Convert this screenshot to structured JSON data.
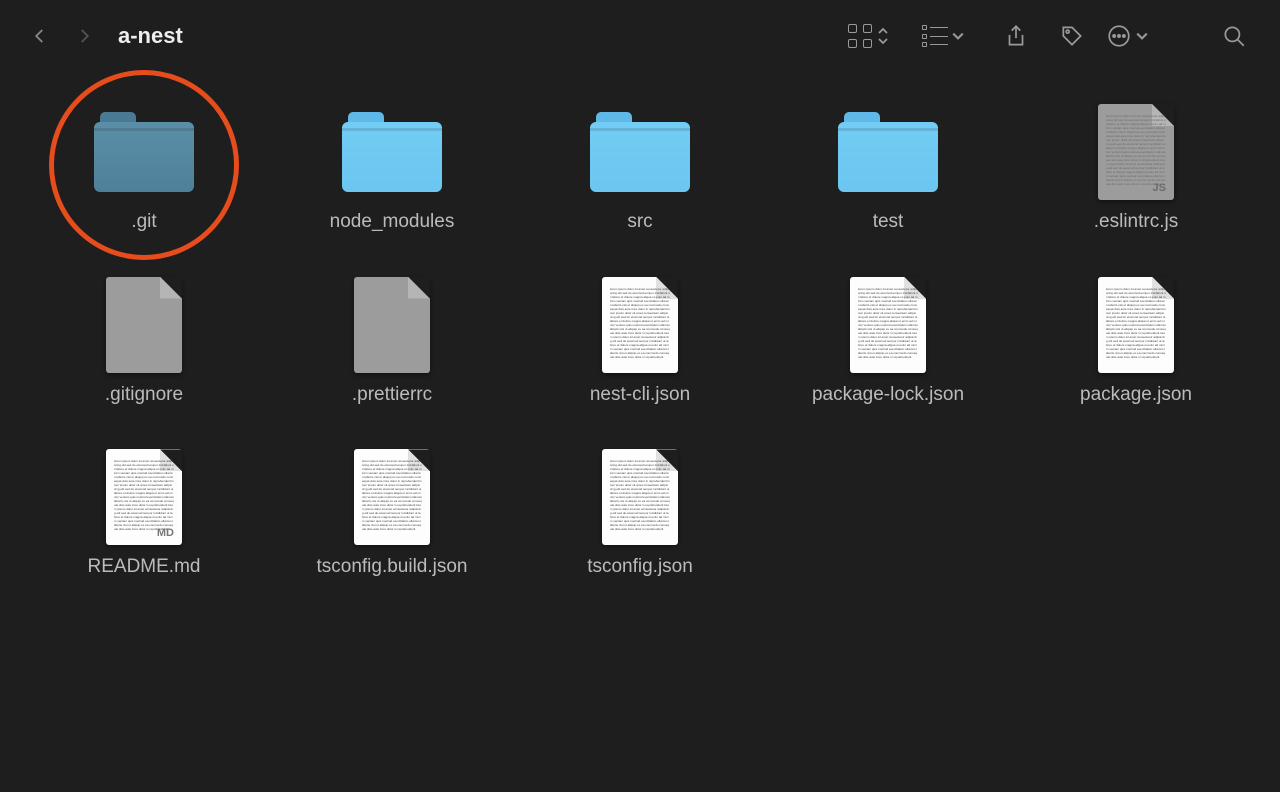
{
  "window": {
    "title": "a-nest"
  },
  "items": [
    {
      "name": ".git",
      "type": "folder",
      "variant": "dim",
      "annotated": true
    },
    {
      "name": "node_modules",
      "type": "folder",
      "variant": "light"
    },
    {
      "name": "src",
      "type": "folder",
      "variant": "light"
    },
    {
      "name": "test",
      "type": "folder",
      "variant": "light"
    },
    {
      "name": ".eslintrc.js",
      "type": "file",
      "variant": "grey",
      "badge": "JS",
      "textfill": true
    },
    {
      "name": ".gitignore",
      "type": "file",
      "variant": "grey"
    },
    {
      "name": ".prettierrc",
      "type": "file",
      "variant": "grey"
    },
    {
      "name": "nest-cli.json",
      "type": "file",
      "variant": "white",
      "textfill": true
    },
    {
      "name": "package-lock.json",
      "type": "file",
      "variant": "white",
      "textfill": true
    },
    {
      "name": "package.json",
      "type": "file",
      "variant": "white",
      "textfill": true
    },
    {
      "name": "README.md",
      "type": "file",
      "variant": "white",
      "badge": "MD",
      "textfill": true
    },
    {
      "name": "tsconfig.build.json",
      "type": "file",
      "variant": "white",
      "textfill": true
    },
    {
      "name": "tsconfig.json",
      "type": "file",
      "variant": "white",
      "textfill": true
    }
  ],
  "annotation": {
    "color": "#e74c1c"
  }
}
